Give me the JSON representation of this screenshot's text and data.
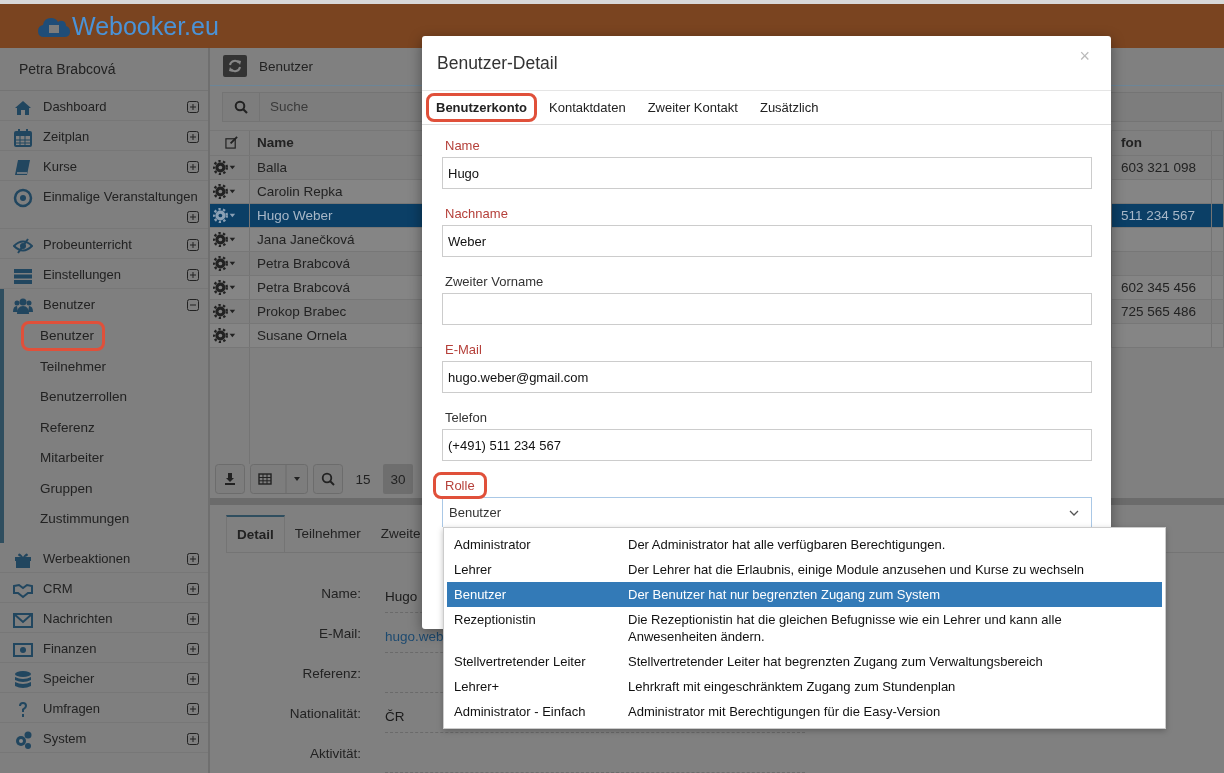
{
  "brand": "Webooker.eu",
  "sidebar": {
    "user": "Petra Brabcová",
    "items": [
      {
        "label": "Dashboard",
        "expanded": false
      },
      {
        "label": "Zeitplan",
        "expanded": false
      },
      {
        "label": "Kurse",
        "expanded": false
      },
      {
        "label": "Einmalige Veranstaltungen",
        "expanded": false
      },
      {
        "label": "Probeunterricht",
        "expanded": false
      },
      {
        "label": "Einstellungen",
        "expanded": false
      },
      {
        "label": "Benutzer",
        "expanded": true,
        "children": [
          {
            "label": "Benutzer",
            "selected": true
          },
          {
            "label": "Teilnehmer",
            "selected": false
          },
          {
            "label": "Benutzerrollen",
            "selected": false
          },
          {
            "label": "Referenz",
            "selected": false
          },
          {
            "label": "Mitarbeiter",
            "selected": false
          },
          {
            "label": "Gruppen",
            "selected": false
          },
          {
            "label": "Zustimmungen",
            "selected": false
          }
        ]
      },
      {
        "label": "Werbeaktionen",
        "expanded": false
      },
      {
        "label": "CRM",
        "expanded": false
      },
      {
        "label": "Nachrichten",
        "expanded": false
      },
      {
        "label": "Finanzen",
        "expanded": false
      },
      {
        "label": "Speicher",
        "expanded": false
      },
      {
        "label": "Umfragen",
        "expanded": false
      },
      {
        "label": "System",
        "expanded": false
      }
    ]
  },
  "content": {
    "title": "Benutzer",
    "search": {
      "placeholder": "Suche"
    },
    "table": {
      "columns": [
        "Name",
        "fon"
      ],
      "rows": [
        {
          "name": "Balla",
          "phone": "603 321 098",
          "selected": false
        },
        {
          "name": "Carolin Repka",
          "selected": false
        },
        {
          "name": "Hugo Weber",
          "phone": "511 234 567",
          "selected": true
        },
        {
          "name": "Jana Janečková",
          "selected": false
        },
        {
          "name": "Petra Brabcová",
          "selected": false
        },
        {
          "name": "Petra Brabcová",
          "phone": "602 345 456",
          "selected": false
        },
        {
          "name": "Prokop Brabec",
          "phone": "725 565 486",
          "selected": false
        },
        {
          "name": "Susane Ornela",
          "selected": false
        }
      ]
    },
    "pagination": [
      {
        "label": "15",
        "selected": false
      },
      {
        "label": "30",
        "selected": true
      }
    ],
    "detail": {
      "tabs": [
        {
          "label": "Detail",
          "selected": true
        },
        {
          "label": "Teilnehmer",
          "selected": false
        },
        {
          "label": "Zweite",
          "selected": false
        }
      ],
      "fields": [
        {
          "label": "Name:",
          "value": "Hugo",
          "kind": "text"
        },
        {
          "label": "E-Mail:",
          "value": "hugo.web",
          "kind": "link"
        },
        {
          "label": "Referenz:",
          "kind": "text"
        },
        {
          "label": "Nationalität:",
          "value": "ČR",
          "kind": "text"
        },
        {
          "label": "Aktivität:",
          "kind": "text"
        }
      ]
    }
  },
  "modal": {
    "title": "Benutzer-Detail",
    "close": "×",
    "tabs": [
      {
        "label": "Benutzerkonto",
        "selected": true,
        "highlighted": true
      },
      {
        "label": "Kontaktdaten",
        "selected": false,
        "highlighted": false
      },
      {
        "label": "Zweiter Kontakt",
        "selected": false,
        "highlighted": false
      },
      {
        "label": "Zusätzlich",
        "selected": false,
        "highlighted": false
      }
    ],
    "fields": [
      {
        "label": "Name",
        "required": true,
        "value": "Hugo"
      },
      {
        "label": "Nachname",
        "required": true,
        "value": "Weber"
      },
      {
        "label": "Zweiter Vorname",
        "required": false
      },
      {
        "label": "E-Mail",
        "required": true,
        "value": "hugo.weber@gmail.com"
      },
      {
        "label": "Telefon",
        "required": false,
        "value": "(+491) 511 234 567"
      }
    ],
    "role": {
      "label": "Rolle",
      "required": true,
      "highlighted": true,
      "value": "Benutzer",
      "options": [
        {
          "name": "Administrator",
          "description": "Der Administrator hat alle verfügbaren Berechtigungen.",
          "selected": false
        },
        {
          "name": "Lehrer",
          "description": "Der Lehrer hat die Erlaubnis, einige Module anzusehen und Kurse zu wechseln",
          "selected": false
        },
        {
          "name": "Benutzer",
          "description": "Der Benutzer hat nur begrenzten Zugang zum System",
          "selected": true
        },
        {
          "name": "Rezeptionistin",
          "description": "Die Rezeptionistin hat die gleichen Befugnisse wie ein Lehrer und kann alle Anwesenheiten ändern.",
          "selected": false
        },
        {
          "name": "Stellvertretender Leiter",
          "description": "Stellvertretender Leiter hat begrenzten Zugang zum Verwaltungsbereich",
          "selected": false
        },
        {
          "name": "Lehrer+",
          "description": "Lehrkraft mit eingeschränktem Zugang zum Stundenplan",
          "selected": false
        },
        {
          "name": "Administrator - Einfach",
          "description": "Administrator mit Berechtigungen für die Easy-Version",
          "selected": false
        }
      ]
    }
  }
}
